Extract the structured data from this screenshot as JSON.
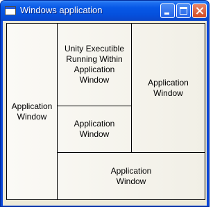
{
  "window": {
    "title": "Windows application",
    "icon": "app-window-icon",
    "controls": [
      "minimize-icon",
      "maximize-icon",
      "close-icon"
    ]
  },
  "panels": {
    "left": [
      "Application",
      "Window"
    ],
    "top_center": [
      "Unity Executible",
      "Running Within",
      "Application",
      "Window"
    ],
    "middle_center": [
      "Application",
      "Window"
    ],
    "right": [
      "Application",
      "Window"
    ],
    "bottom": [
      "Application",
      "Window"
    ]
  },
  "colors": {
    "titlebar": "#0550dd",
    "frame": "#0a46d8",
    "close_button": "#d54a21",
    "client": "#ece9d8"
  }
}
